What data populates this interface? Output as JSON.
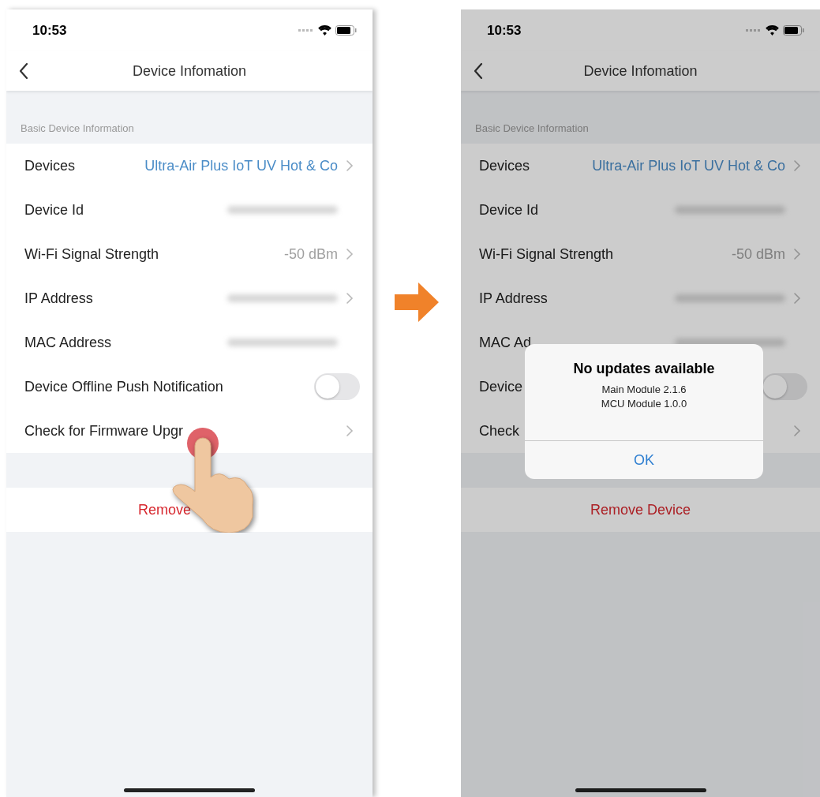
{
  "screens": [
    {
      "status_bar": {
        "time": "10:53"
      },
      "nav": {
        "title": "Device Infomation"
      },
      "section_header": "Basic Device Information",
      "rows": [
        {
          "kind": "value",
          "label": "Devices",
          "value": "Ultra-Air Plus IoT UV Hot & Co",
          "link": true,
          "chevron": true
        },
        {
          "kind": "blurred",
          "label": "Device Id",
          "chevron": false
        },
        {
          "kind": "value",
          "label": "Wi-Fi Signal Strength",
          "value": "-50 dBm",
          "link": false,
          "chevron": true
        },
        {
          "kind": "blurred",
          "label": "IP Address",
          "chevron": true
        },
        {
          "kind": "blurred",
          "label": "MAC Address",
          "chevron": false
        },
        {
          "kind": "toggle",
          "label": "Device Offline Push Notification",
          "on": false
        },
        {
          "kind": "action",
          "label": "Check for Firmware Upgr",
          "chevron": true
        }
      ],
      "remove_button": {
        "label": "Remove"
      },
      "touch": true,
      "dimmed": false
    },
    {
      "status_bar": {
        "time": "10:53"
      },
      "nav": {
        "title": "Device Infomation"
      },
      "section_header": "Basic Device Information",
      "rows": [
        {
          "kind": "value",
          "label": "Devices",
          "value": "Ultra-Air Plus IoT UV Hot & Co",
          "link": true,
          "chevron": true
        },
        {
          "kind": "blurred",
          "label": "Device Id",
          "chevron": false
        },
        {
          "kind": "value",
          "label": "Wi-Fi Signal Strength",
          "value": "-50 dBm",
          "link": false,
          "chevron": true
        },
        {
          "kind": "blurred",
          "label": "IP Address",
          "chevron": true
        },
        {
          "kind": "blurred",
          "label": "MAC Ad",
          "chevron": false
        },
        {
          "kind": "toggle",
          "label": "Device",
          "on": false
        },
        {
          "kind": "action",
          "label": "Check",
          "chevron": true
        }
      ],
      "remove_button": {
        "label": "Remove Device"
      },
      "touch": false,
      "dimmed": true,
      "dialog": {
        "title": "No updates available",
        "lines": [
          "Main Module 2.1.6",
          "MCU Module 1.0.0"
        ],
        "button": "OK"
      }
    }
  ]
}
